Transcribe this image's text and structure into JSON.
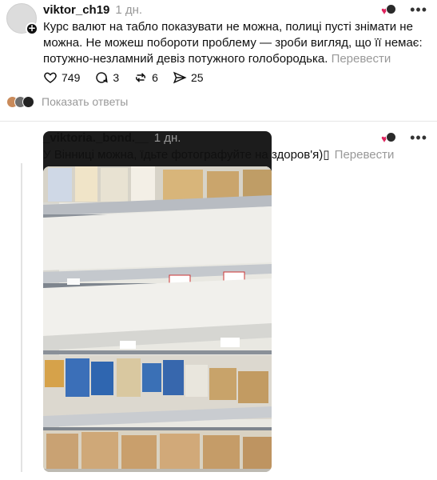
{
  "post1": {
    "username": "viktor_ch19",
    "time": "1 дн.",
    "text": "Курс валют на табло показувати не можна, полиці пусті знімати не можна. Не можеш побороти проблему — зроби вигляд, що її немає: потужно-незламний девіз потужного голобородька.",
    "translate": "Перевести",
    "likes": "749",
    "comments": "3",
    "reposts": "6",
    "shares": "25",
    "show_replies": "Показать ответы"
  },
  "post2": {
    "username": "_viktoria._bond.__",
    "time": "1 дн.",
    "text": "У Вінниці можна, їдьте фотографуйте на здоров'я)",
    "emoji_glyph": "▯",
    "translate": "Перевести"
  },
  "icons": {
    "more": "more-dots-icon",
    "like": "heart-icon",
    "comment": "comment-icon",
    "repost": "repost-icon",
    "share": "send-icon",
    "follow": "plus-icon"
  },
  "colors": {
    "text": "#101010",
    "muted": "#999999",
    "like_red": "#e0245e",
    "divider": "#e6e6e6"
  }
}
